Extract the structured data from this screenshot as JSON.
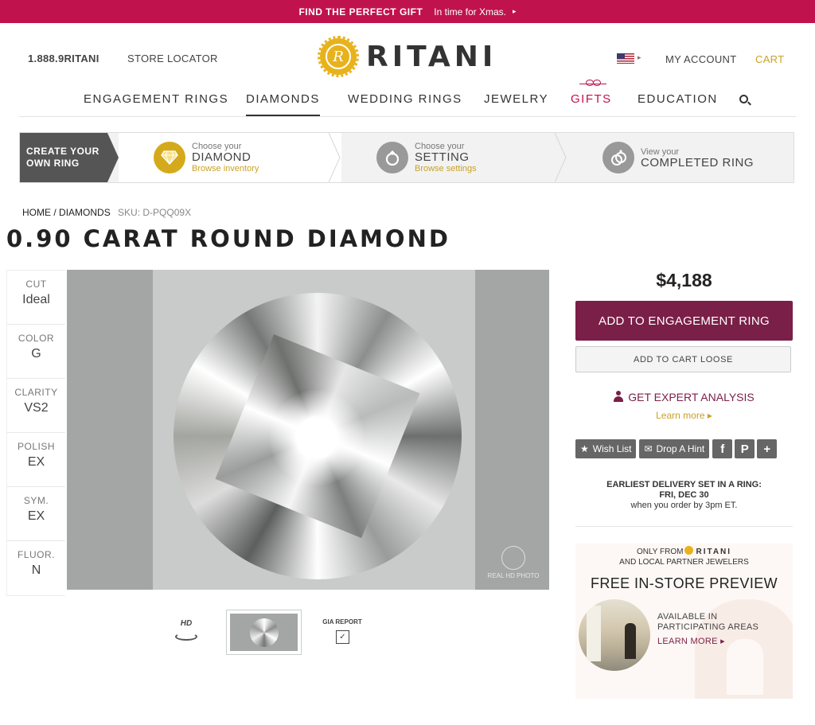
{
  "promo": {
    "headline": "FIND THE PERFECT GIFT",
    "subtext": "In time for Xmas.",
    "arrow": "▸"
  },
  "header": {
    "phone": "1.888.9RITANI",
    "store_locator": "STORE LOCATOR",
    "logo_text": "RITANI",
    "logo_letter": "R",
    "my_account": "MY ACCOUNT",
    "cart": "CART",
    "flag_caret": "▸"
  },
  "nav": {
    "items": [
      {
        "label": "ENGAGEMENT RINGS"
      },
      {
        "label": "DIAMONDS"
      },
      {
        "label": "WEDDING RINGS"
      },
      {
        "label": "JEWELRY"
      },
      {
        "label": "GIFTS"
      },
      {
        "label": "EDUCATION"
      }
    ],
    "active": "DIAMONDS"
  },
  "steps": {
    "first": "CREATE YOUR OWN RING",
    "items": [
      {
        "small": "Choose your",
        "big": "DIAMOND",
        "link": "Browse inventory",
        "icon": "diamond-icon"
      },
      {
        "small": "Choose your",
        "big": "SETTING",
        "link": "Browse settings",
        "icon": "ring-icon"
      },
      {
        "small": "View your",
        "big": "COMPLETED RING",
        "link": "",
        "icon": "rings-icon"
      }
    ]
  },
  "breadcrumb": {
    "home": "HOME",
    "sep": "/",
    "diamonds": "DIAMONDS",
    "sku": "SKU: D-PQQ09X"
  },
  "product": {
    "title": "0.90 CARAT ROUND DIAMOND",
    "specs": [
      {
        "label": "CUT",
        "value": "Ideal"
      },
      {
        "label": "COLOR",
        "value": "G"
      },
      {
        "label": "CLARITY",
        "value": "VS2"
      },
      {
        "label": "POLISH",
        "value": "EX"
      },
      {
        "label": "SYM.",
        "value": "EX"
      },
      {
        "label": "FLUOR.",
        "value": "N"
      }
    ],
    "image_badge": "REAL HD PHOTO",
    "thumbs": {
      "hd_label": "HD",
      "gia_label": "GIA REPORT"
    }
  },
  "purchase": {
    "price": "$4,188",
    "add_to_ring": "ADD TO ENGAGEMENT RING",
    "add_to_cart": "ADD TO CART LOOSE",
    "expert": "GET EXPERT ANALYSIS",
    "learn_more": "Learn more ▸",
    "social": {
      "wishlist": "Wish List",
      "hint": "Drop A Hint",
      "facebook": "f",
      "pinterest": "P",
      "plus": "+"
    },
    "delivery": {
      "line1": "EARLIEST DELIVERY SET IN A RING:",
      "line2": "FRI, DEC 30",
      "line3": "when you order by 3pm ET."
    }
  },
  "preview": {
    "only_from": "ONLY FROM",
    "brand": "RITANI",
    "partners": "AND LOCAL PARTNER JEWELERS",
    "headline": "FREE IN-STORE PREVIEW",
    "avail1": "AVAILABLE IN",
    "avail2": "PARTICIPATING AREAS",
    "learn_more": "LEARN MORE ▸"
  },
  "colors": {
    "promo": "#c0134d",
    "primary": "#7a1f47",
    "gold": "#c9a227",
    "logo": "#e8b21d"
  }
}
